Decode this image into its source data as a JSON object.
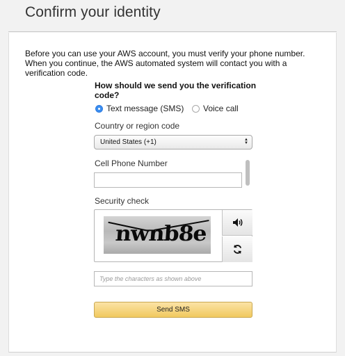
{
  "page": {
    "title": "Confirm your identity",
    "intro": "Before you can use your AWS account, you must verify your phone number. When you continue, the AWS automated system will contact you with a verification code."
  },
  "method": {
    "question": "How should we send you the verification code?",
    "options": [
      {
        "label": "Text message (SMS)",
        "selected": true
      },
      {
        "label": "Voice call",
        "selected": false
      }
    ]
  },
  "country": {
    "label": "Country or region code",
    "selected": "United States (+1)"
  },
  "phone": {
    "label": "Cell Phone Number",
    "value": ""
  },
  "security": {
    "label": "Security check",
    "captcha_text": "nwnb8e",
    "audio_icon": "speaker-icon",
    "refresh_icon": "refresh-icon",
    "input_placeholder": "Type the characters as shown above"
  },
  "actions": {
    "send_label": "Send SMS"
  },
  "colors": {
    "radio_selected": "#3b8ef0",
    "send_button": "#f1c95e"
  }
}
